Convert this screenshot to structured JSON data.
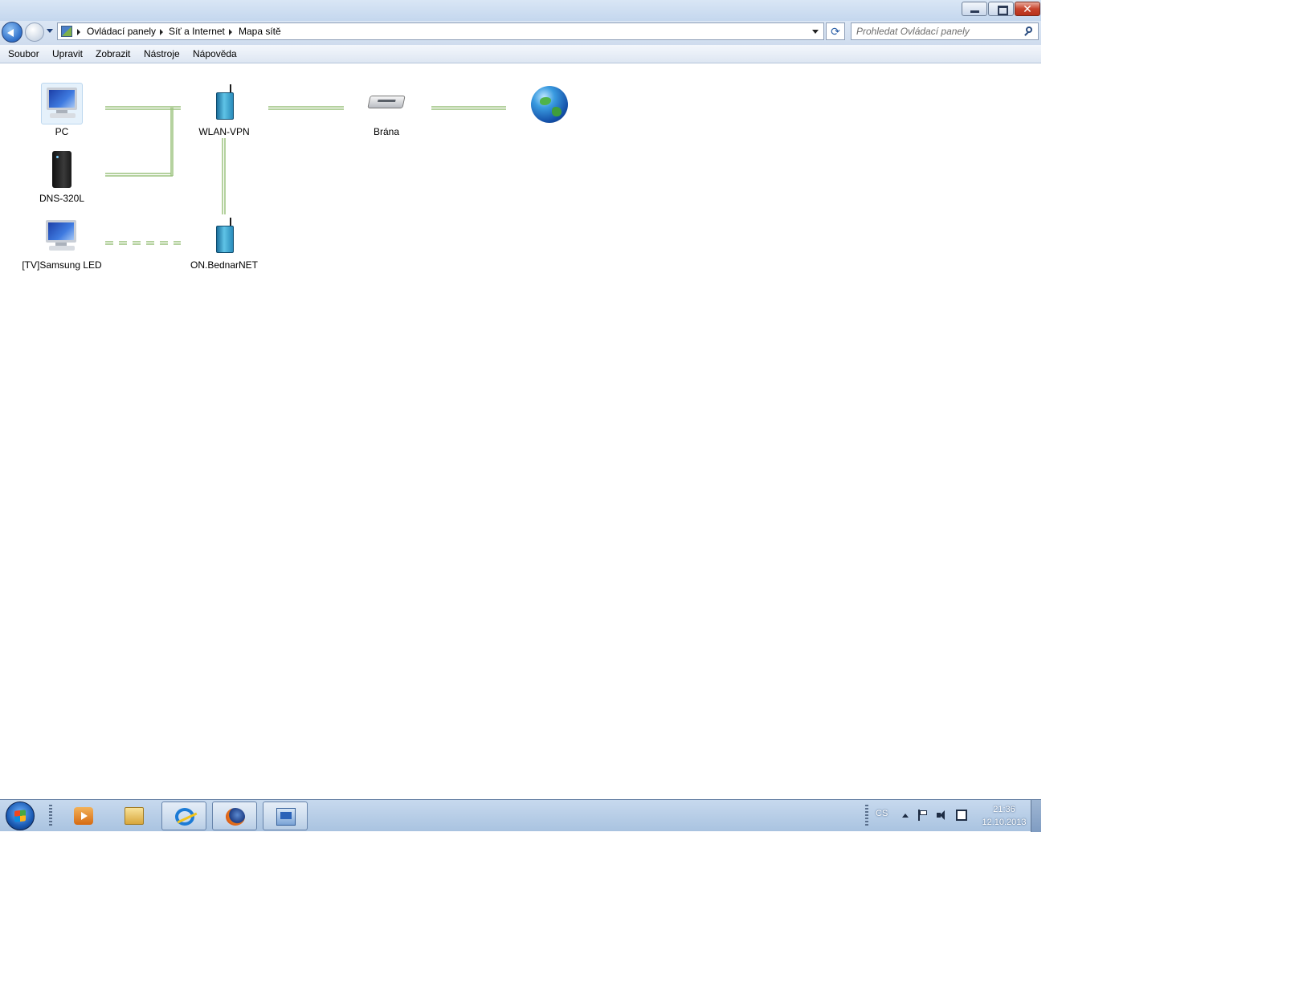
{
  "window": {
    "caption_buttons": {
      "minimize": "minimize-icon",
      "maximize": "restore-icon",
      "close": "close-icon",
      "close_glyph": "✕"
    }
  },
  "address_bar": {
    "root_icon": "control-panel-icon",
    "breadcrumbs": [
      "Ovládací panely",
      "Síť a Internet",
      "Mapa sítě"
    ],
    "refresh_glyph": "⟳"
  },
  "search": {
    "placeholder": "Prohledat Ovládací panely"
  },
  "menu": [
    "Soubor",
    "Upravit",
    "Zobrazit",
    "Nástroje",
    "Nápověda"
  ],
  "network_map": {
    "nodes": [
      {
        "label": "PC",
        "icon": "computer-icon"
      },
      {
        "label": "DNS-320L",
        "icon": "nas-icon"
      },
      {
        "label": "[TV]Samsung LED",
        "icon": "computer-icon"
      },
      {
        "label": "WLAN-VPN",
        "icon": "wireless-access-point-icon"
      },
      {
        "label": "ON.BednarNET",
        "icon": "wireless-access-point-icon"
      },
      {
        "label": "Brána",
        "icon": "gateway-icon"
      },
      {
        "label": "",
        "icon": "internet-globe-icon"
      }
    ],
    "links": [
      {
        "from": "PC",
        "to": "WLAN-VPN",
        "style": "wired"
      },
      {
        "from": "DNS-320L",
        "to": "WLAN-VPN",
        "style": "wired"
      },
      {
        "from": "WLAN-VPN",
        "to": "ON.BednarNET",
        "style": "wired"
      },
      {
        "from": "[TV]Samsung LED",
        "to": "ON.BednarNET",
        "style": "wireless-dashed"
      },
      {
        "from": "WLAN-VPN",
        "to": "Brána",
        "style": "wired"
      },
      {
        "from": "Brána",
        "to": "Internet",
        "style": "wired"
      }
    ],
    "link_color": "#9cc27f"
  },
  "taskbar": {
    "start": "windows-start-icon",
    "buttons": [
      {
        "icon": "media-player-icon",
        "active": false
      },
      {
        "icon": "explorer-folder-icon",
        "active": false
      },
      {
        "icon": "internet-explorer-icon",
        "active": true
      },
      {
        "icon": "firefox-icon",
        "active": true
      },
      {
        "icon": "network-map-icon",
        "active": true
      }
    ],
    "tray": {
      "language": "CS",
      "time": "21:36",
      "date": "12.10.2013"
    }
  }
}
